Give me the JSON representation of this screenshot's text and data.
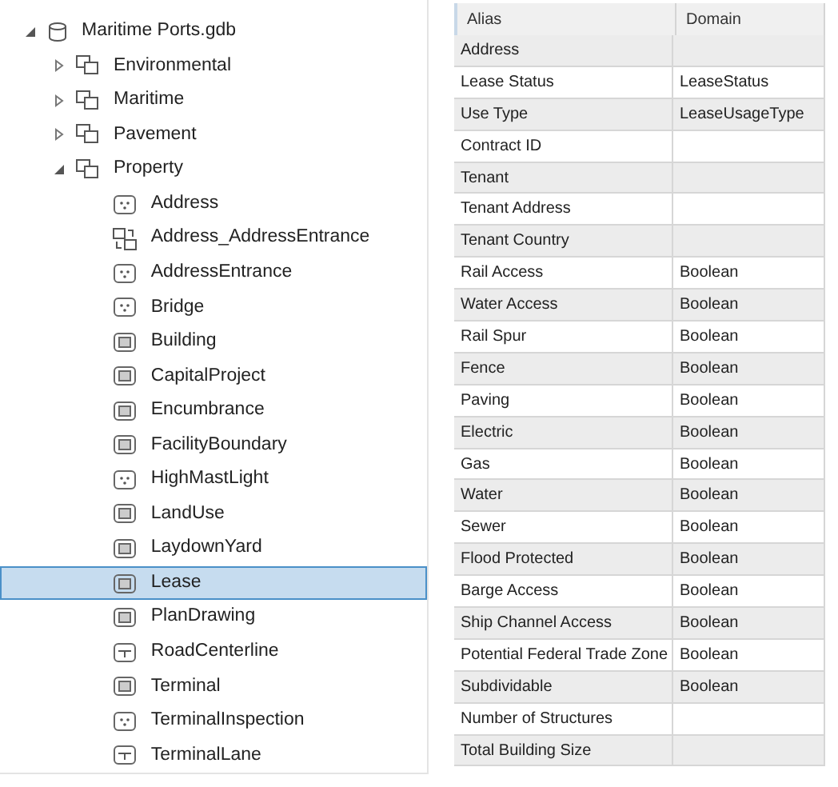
{
  "tree": {
    "name": "Maritime Ports.gdb",
    "kind": "database",
    "expanded": true,
    "selected": false,
    "children": [
      {
        "name": "Environmental",
        "kind": "dataset",
        "expanded": false,
        "selected": false
      },
      {
        "name": "Maritime",
        "kind": "dataset",
        "expanded": false,
        "selected": false
      },
      {
        "name": "Pavement",
        "kind": "dataset",
        "expanded": false,
        "selected": false
      },
      {
        "name": "Property",
        "kind": "dataset",
        "expanded": true,
        "selected": false,
        "children": [
          {
            "name": "Address",
            "kind": "point",
            "selected": false
          },
          {
            "name": "Address_AddressEntrance",
            "kind": "relationship",
            "selected": false
          },
          {
            "name": "AddressEntrance",
            "kind": "point",
            "selected": false
          },
          {
            "name": "Bridge",
            "kind": "point",
            "selected": false
          },
          {
            "name": "Building",
            "kind": "polygon",
            "selected": false
          },
          {
            "name": "CapitalProject",
            "kind": "polygon",
            "selected": false
          },
          {
            "name": "Encumbrance",
            "kind": "polygon",
            "selected": false
          },
          {
            "name": "FacilityBoundary",
            "kind": "polygon",
            "selected": false
          },
          {
            "name": "HighMastLight",
            "kind": "point",
            "selected": false
          },
          {
            "name": "LandUse",
            "kind": "polygon",
            "selected": false
          },
          {
            "name": "LaydownYard",
            "kind": "polygon",
            "selected": false
          },
          {
            "name": "Lease",
            "kind": "polygon",
            "selected": true
          },
          {
            "name": "PlanDrawing",
            "kind": "polygon",
            "selected": false
          },
          {
            "name": "RoadCenterline",
            "kind": "line",
            "selected": false
          },
          {
            "name": "Terminal",
            "kind": "polygon",
            "selected": false
          },
          {
            "name": "TerminalInspection",
            "kind": "point",
            "selected": false
          },
          {
            "name": "TerminalLane",
            "kind": "line",
            "selected": false
          }
        ]
      }
    ]
  },
  "table": {
    "columns": [
      "Alias",
      "Domain"
    ],
    "rows": [
      [
        "Address",
        ""
      ],
      [
        "Lease Status",
        "LeaseStatus"
      ],
      [
        "Use Type",
        "LeaseUsageType"
      ],
      [
        "Contract ID",
        ""
      ],
      [
        "Tenant",
        ""
      ],
      [
        "Tenant Address",
        ""
      ],
      [
        "Tenant Country",
        ""
      ],
      [
        "Rail Access",
        "Boolean"
      ],
      [
        "Water Access",
        "Boolean"
      ],
      [
        "Rail Spur",
        "Boolean"
      ],
      [
        "Fence",
        "Boolean"
      ],
      [
        "Paving",
        "Boolean"
      ],
      [
        "Electric",
        "Boolean"
      ],
      [
        "Gas",
        "Boolean"
      ],
      [
        "Water",
        "Boolean"
      ],
      [
        "Sewer",
        "Boolean"
      ],
      [
        "Flood Protected",
        "Boolean"
      ],
      [
        "Barge Access",
        "Boolean"
      ],
      [
        "Ship Channel Access",
        "Boolean"
      ],
      [
        "Potential Federal Trade Zone",
        "Boolean"
      ],
      [
        "Subdividable",
        "Boolean"
      ],
      [
        "Number of Structures",
        ""
      ],
      [
        "Total Building Size",
        ""
      ]
    ]
  }
}
